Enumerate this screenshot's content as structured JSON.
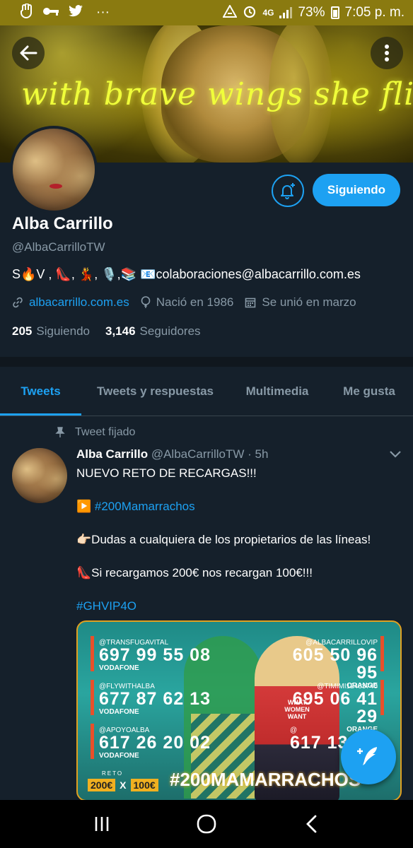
{
  "status_bar": {
    "left_icons": [
      "hand-icon",
      "key-icon",
      "twitter-icon"
    ],
    "more": "···",
    "network": "4G",
    "battery": "73%",
    "time": "7:05 p. m."
  },
  "banner": {
    "text": "with brave wings she flies"
  },
  "profile": {
    "follow_button": "Siguiendo",
    "name": "Alba Carrillo",
    "handle": "@AlbaCarrilloTW",
    "bio": "S🔥V , 👠, 💃, 🎙️,📚 📧colaboraciones@albacarrillo.com.es",
    "website": "albacarrillo.com.es",
    "birth": "Nació en 1986",
    "joined": "Se unió en marzo",
    "following_count": "205",
    "following_label": "Siguiendo",
    "followers_count": "3,146",
    "followers_label": "Seguidores"
  },
  "tabs": [
    {
      "label": "Tweets",
      "active": true
    },
    {
      "label": "Tweets y respuestas",
      "active": false
    },
    {
      "label": "Multimedia",
      "active": false
    },
    {
      "label": "Me gusta",
      "active": false
    }
  ],
  "tweet": {
    "pinned_label": "Tweet fijado",
    "author": "Alba Carrillo",
    "handle": "@AlbaCarrilloTW",
    "separator": "·",
    "time": "5h",
    "line1": "NUEVO RETO DE RECARGAS!!!",
    "line2": "▶️ #200Mamarrachos",
    "line3": "👉🏻Dudas a cualquiera de los propietarios de las líneas!",
    "line4": "👠Si recargamos 200€ nos recargan 100€!!!",
    "line5": "#GHVIP4O"
  },
  "media": {
    "left": [
      {
        "handle": "@TRANSFUGAVITAL",
        "number": "697 99 55 08",
        "operator": "VODAFONE"
      },
      {
        "handle": "@FLYWITHALBA",
        "number": "677 87 62 13",
        "operator": "VODAFONE"
      },
      {
        "handle": "@APOYOALBA",
        "number": "617 26 20 02",
        "operator": "VODAFONE"
      }
    ],
    "right": [
      {
        "handle": "@ALBACARRILLOVIP",
        "number": "605 50 96 95",
        "operator": "ORANGE"
      },
      {
        "handle": "@TIMIMI12483740",
        "number": "695 06 41 29",
        "operator": "ORANGE"
      },
      {
        "handle": "@",
        "number": "617 13",
        "operator": ""
      }
    ],
    "shirt_text": "WHAT WOMEN WANT",
    "reto": "RETO",
    "promo_a": "200€",
    "promo_x": "X",
    "promo_b": "100€",
    "hashtag": "#200MAMARRACHOS"
  },
  "colors": {
    "accent": "#1da1f2",
    "background": "#15202b",
    "muted": "#8899a6",
    "status_bar": "#8a7a10"
  }
}
